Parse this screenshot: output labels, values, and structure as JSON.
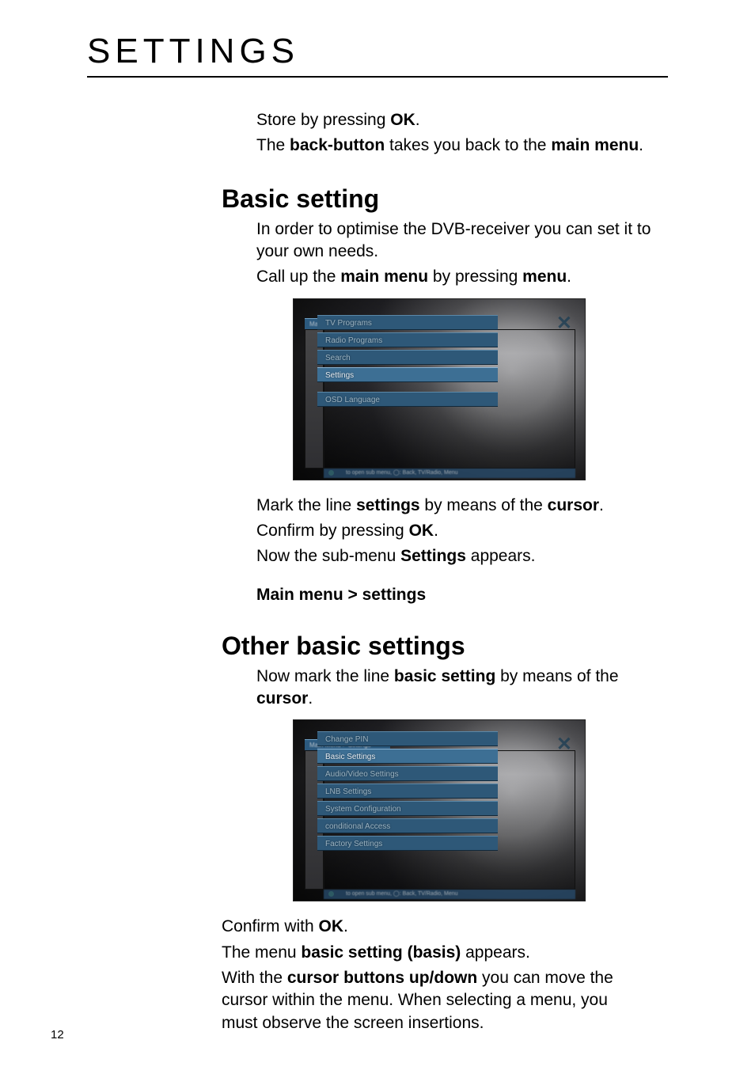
{
  "page_title": "SETTINGS",
  "page_number": "12",
  "intro": {
    "line1_pre": "Store by pressing ",
    "line1_b1": "OK",
    "line1_post": ".",
    "line2_pre": "The ",
    "line2_b1": "back-button",
    "line2_mid": " takes you back to the ",
    "line2_b2": "main menu",
    "line2_post": "."
  },
  "sec_basic_heading": "Basic setting",
  "basic": {
    "p1": "In order to optimise the DVB-receiver you can set it to your own needs.",
    "p2_pre": "Call up the  ",
    "p2_b1": "main menu",
    "p2_mid": " by pressing ",
    "p2_b2": "menu",
    "p2_post": "."
  },
  "fig1": {
    "header": "Main Menu",
    "items": [
      "TV Programs",
      "Radio Programs",
      "Search",
      "Settings"
    ],
    "isolated": "OSD Language",
    "helpline": "to open sub menu, ◯: Back, TV/Radio, Menu"
  },
  "after_fig1": {
    "l1_pre": "Mark the line ",
    "l1_b1": "settings",
    "l1_mid": " by means of the ",
    "l1_b2": "cursor",
    "l1_post": ".",
    "l2_pre": "Confirm by pressing ",
    "l2_b1": "OK",
    "l2_post": ".",
    "l3_pre": "Now the sub-menu ",
    "l3_b1": "Settings",
    "l3_post": " appears."
  },
  "breadcrumb": "Main menu > settings",
  "sec_other_heading": "Other basic settings",
  "other": {
    "p1_pre": "Now mark the line ",
    "p1_b1": "basic setting",
    "p1_mid": " by means of the ",
    "p1_b2": "cursor",
    "p1_post": "."
  },
  "fig2": {
    "header": "Main Menu > Settings",
    "items": [
      "Change PIN",
      "Basic Settings",
      "Audio/Video Settings",
      "LNB Settings",
      "System Configuration",
      "conditional Access",
      "Factory Settings"
    ],
    "helpline": "to open sub menu, ◯: Back, TV/Radio, Menu"
  },
  "after_fig2": {
    "l1_pre": "Confirm with ",
    "l1_b1": "OK",
    "l1_post": ".",
    "l2_pre": "The menu ",
    "l2_b1": "basic setting (basis)",
    "l2_post": " appears.",
    "l3_pre": "With the ",
    "l3_b1": "cursor buttons up/down",
    "l3_post": " you can move the cursor within the menu. When selecting a menu, you must observe the screen insertions."
  }
}
